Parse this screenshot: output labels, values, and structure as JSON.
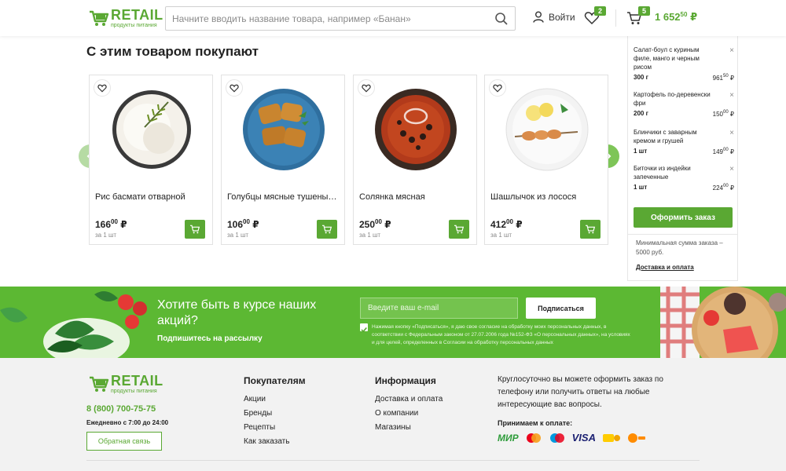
{
  "header": {
    "logo_word": "RETAIL",
    "logo_sub": "продукты питания",
    "search_placeholder": "Начните вводить название товара, например «Банан»",
    "login_label": "Войти",
    "favorites_count": "2",
    "cart_count": "5",
    "cart_total_main": "1 652",
    "cart_total_cents": "50",
    "currency": "₽"
  },
  "section_title": "С этим товаром покупают",
  "products": [
    {
      "name": "Рис басмати отварной",
      "price_main": "166",
      "price_cents": "00",
      "currency": "₽",
      "unit": "за 1 шт"
    },
    {
      "name": "Голубцы мясные тушеные в томатном соусе",
      "price_main": "106",
      "price_cents": "00",
      "currency": "₽",
      "unit": "за 1 шт"
    },
    {
      "name": "Солянка мясная",
      "price_main": "250",
      "price_cents": "00",
      "currency": "₽",
      "unit": "за 1 шт"
    },
    {
      "name": "Шашлычок из лосося",
      "price_main": "412",
      "price_cents": "00",
      "currency": "₽",
      "unit": "за 1 шт"
    }
  ],
  "minicart": {
    "items": [
      {
        "name": "Салат-боул с куриным филе, манго и черным рисом",
        "qty": "300 г",
        "price_main": "961",
        "price_cents": "50",
        "currency": "₽"
      },
      {
        "name": "Картофель по-деревенски фри",
        "qty": "200 г",
        "price_main": "150",
        "price_cents": "00",
        "currency": "₽"
      },
      {
        "name": "Блинчики с заварным кремом и грушей",
        "qty": "1 шт",
        "price_main": "149",
        "price_cents": "00",
        "currency": "₽"
      },
      {
        "name": "Биточки из индейки запеченные",
        "qty": "1 шт",
        "price_main": "224",
        "price_cents": "00",
        "currency": "₽"
      }
    ],
    "remove_glyph": "×",
    "order_button": "Оформить заказ",
    "min_order": "Минимальная сумма заказа – 5000 руб.",
    "delivery_link": "Доставка и оплата"
  },
  "newsletter": {
    "title": "Хотите быть в курсе наших акций?",
    "subtitle": "Подпишитесь на рассылку",
    "email_placeholder": "Введите ваш e-mail",
    "subscribe_button": "Подписаться",
    "consent": "Нажимая кнопку «Подписаться», я даю свое согласие на обработку моих персональных данных, в соответствии с Федеральным законом от 27.07.2006 года №152-ФЗ «О персональных данных», на условиях и для целей, определенных в Согласии на обработку персональных данных"
  },
  "footer": {
    "logo_word": "RETAIL",
    "logo_sub": "продукты питания",
    "phone": "8 (800) 700-75-75",
    "hours": "Ежедневно с 7:00 до 24:00",
    "feedback_button": "Обратная связь",
    "col1": {
      "title": "Покупателям",
      "links": [
        "Акции",
        "Бренды",
        "Рецепты",
        "Как заказать"
      ]
    },
    "col2": {
      "title": "Информация",
      "links": [
        "Доставка и оплата",
        "О компании",
        "Магазины"
      ]
    },
    "info_text": "Круглосуточно вы можете оформить заказ по телефону или получить ответы на любые интересующие вас вопросы.",
    "payment_title": "Принимаем к оплате:",
    "payment_methods": [
      "МИР",
      "Mastercard",
      "Maestro",
      "VISA",
      "Яндекс Деньги",
      "QIWI"
    ]
  },
  "colors": {
    "brand_green": "#5aa833",
    "newsletter_green": "#5cb833"
  }
}
